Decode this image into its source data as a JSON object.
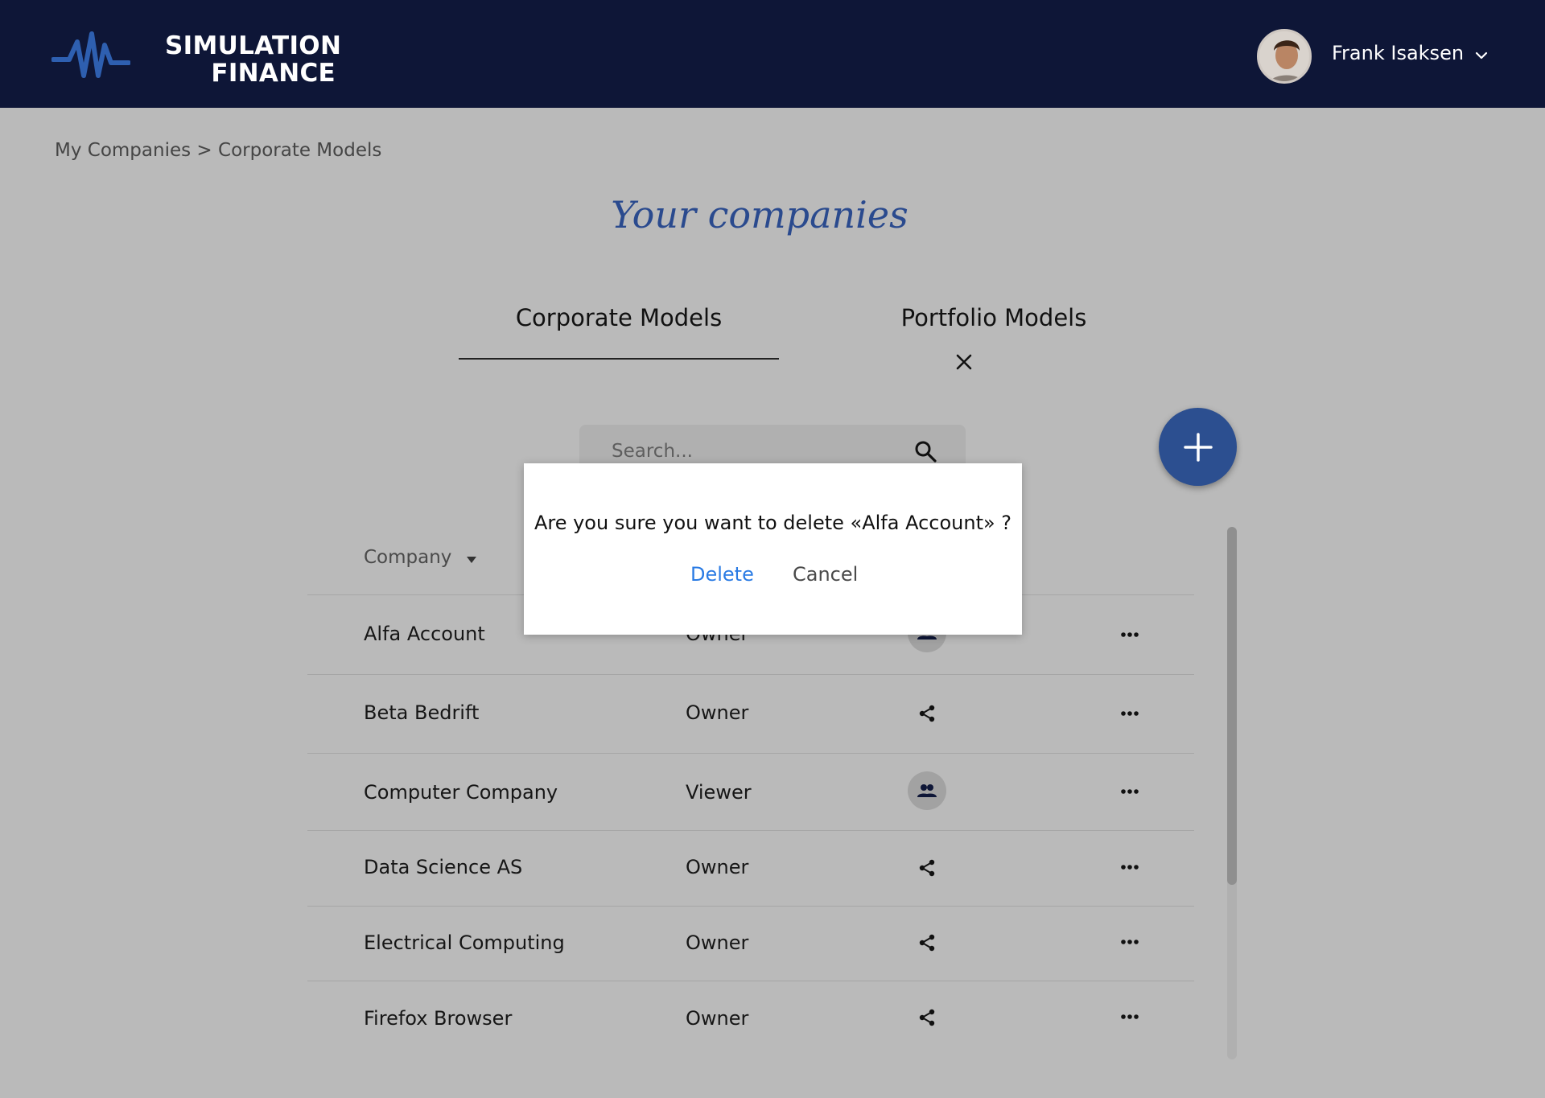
{
  "header": {
    "logo_line1": "SIMULATION",
    "logo_line2": "FINANCE",
    "user_name": "Frank Isaksen",
    "logo_icon": "wave-logo-icon",
    "menu_icon": "chevron-down-icon"
  },
  "breadcrumb": {
    "item1": "My Companies",
    "separator": " > ",
    "item2": "Corporate Models"
  },
  "page_title": "Your companies",
  "tabs": [
    {
      "label": "Corporate Models",
      "active": true
    },
    {
      "label": "Portfolio Models",
      "active": false
    }
  ],
  "search": {
    "placeholder": "Search..."
  },
  "table": {
    "header_company": "Company",
    "rows": [
      {
        "company": "Alfa Account",
        "role": "Owner",
        "share": "group"
      },
      {
        "company": "Beta Bedrift",
        "role": "Owner",
        "share": "share"
      },
      {
        "company": "Computer Company",
        "role": "Viewer",
        "share": "group"
      },
      {
        "company": "Data Science AS",
        "role": "Owner",
        "share": "share"
      },
      {
        "company": "Electrical Computing",
        "role": "Owner",
        "share": "share"
      },
      {
        "company": "Firefox Browser",
        "role": "Owner",
        "share": "share"
      }
    ]
  },
  "dialog": {
    "message": "Are you sure you want to delete «Alfa Account» ?",
    "delete_label": "Delete",
    "cancel_label": "Cancel"
  },
  "colors": {
    "header_bg": "#0e1637",
    "accent": "#2c4f90",
    "link": "#2a7be4",
    "overlay_bg": "#bababa"
  }
}
